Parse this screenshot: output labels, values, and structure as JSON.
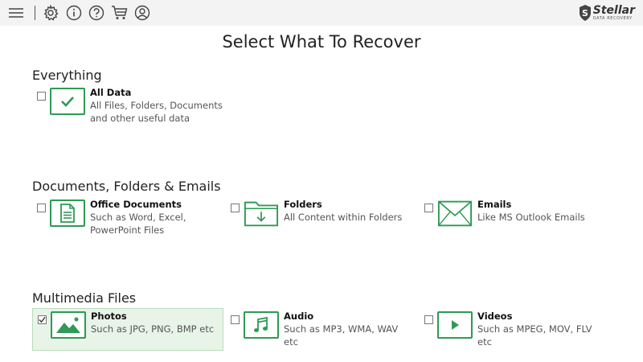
{
  "toolbar": {
    "icons": [
      "menu-icon",
      "gear-icon",
      "info-icon",
      "help-icon",
      "cart-icon",
      "user-icon"
    ],
    "brand": {
      "name": "Stellar",
      "tagline": "DATA RECOVERY"
    }
  },
  "page": {
    "title": "Select What To Recover"
  },
  "sections": {
    "everything": {
      "title": "Everything",
      "all_data": {
        "label": "All Data",
        "desc1": "All Files, Folders, Documents",
        "desc2": "and other useful data",
        "checked": false
      }
    },
    "documents": {
      "title": "Documents, Folders & Emails",
      "office": {
        "label": "Office Documents",
        "desc1": "Such as Word, Excel,",
        "desc2": "PowerPoint Files",
        "checked": false
      },
      "folders": {
        "label": "Folders",
        "desc1": "All Content within Folders",
        "checked": false
      },
      "emails": {
        "label": "Emails",
        "desc1": "Like MS Outlook Emails",
        "checked": false
      }
    },
    "multimedia": {
      "title": "Multimedia Files",
      "photos": {
        "label": "Photos",
        "desc1": "Such as JPG, PNG, BMP etc",
        "checked": true
      },
      "audio": {
        "label": "Audio",
        "desc1": "Such as MP3, WMA, WAV",
        "desc2": "etc",
        "checked": false
      },
      "videos": {
        "label": "Videos",
        "desc1": "Such as MPEG, MOV, FLV",
        "desc2": "etc",
        "checked": false
      }
    }
  },
  "colors": {
    "accent": "#2e9a55",
    "toolbar_bg": "#f3f3f3",
    "selected_bg": "#e8f4e8"
  }
}
